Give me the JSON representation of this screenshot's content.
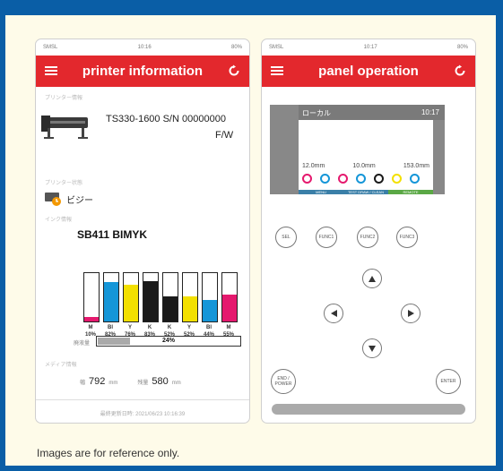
{
  "caption": "Images are for reference only.",
  "phone1": {
    "status": {
      "carrier": "SMSL",
      "time": "10:16",
      "battery": "80%"
    },
    "title": "printer information",
    "section_printer": "プリンター情報",
    "model": "TS330-1600  S/N  00000000",
    "firmware": "F/W",
    "section_status": "プリンター状態",
    "status_text": "ビジー",
    "section_ink": "インク情報",
    "ink_set": "SB411  BIMYK",
    "inks": [
      {
        "name": "M",
        "pct": "10%",
        "level": 10,
        "color": "#e5196e"
      },
      {
        "name": "Bl",
        "pct": "82%",
        "level": 82,
        "color": "#1596d8"
      },
      {
        "name": "Y",
        "pct": "76%",
        "level": 76,
        "color": "#f3e000"
      },
      {
        "name": "K",
        "pct": "83%",
        "level": 83,
        "color": "#1a1a1a"
      },
      {
        "name": "K",
        "pct": "52%",
        "level": 52,
        "color": "#1a1a1a"
      },
      {
        "name": "Y",
        "pct": "52%",
        "level": 52,
        "color": "#f3e000"
      },
      {
        "name": "Bl",
        "pct": "44%",
        "level": 44,
        "color": "#1596d8"
      },
      {
        "name": "M",
        "pct": "55%",
        "level": 55,
        "color": "#e5196e"
      }
    ],
    "progress_label": "廃液量",
    "progress_text": "24%",
    "progress_level": 24,
    "section_media": "メディア情報",
    "media_w_label": "幅",
    "media_w": "792",
    "media_unit": "mm",
    "media_l_label": "残量",
    "media_l": "580",
    "footer": "最終更新日時: 2021/06/23 10:16:39"
  },
  "phone2": {
    "status": {
      "carrier": "SMSL",
      "time": "10:17",
      "battery": "80%"
    },
    "title": "panel operation",
    "lcd_top": "ローカル",
    "lcd_time": "10:17",
    "lcd_values": [
      "12.0mm",
      "10.0mm",
      "153.0mm"
    ],
    "lcd_keys": [
      "MENU",
      "TEST DRAW / CLEAN",
      "REMOTE"
    ],
    "lcd_key_colors": [
      "#3a7fa8",
      "#3a7fa8",
      "#5aa845"
    ],
    "ink_icons": [
      "#e5196e",
      "#1596d8",
      "#e5196e",
      "#1596d8",
      "#1a1a1a",
      "#f3e000",
      "#1596d8"
    ],
    "buttons": {
      "sel": "SEL",
      "func1": "FUNC1",
      "func2": "FUNC2",
      "func3": "FUNC3",
      "end": "END / POWER",
      "enter": "ENTER"
    }
  }
}
